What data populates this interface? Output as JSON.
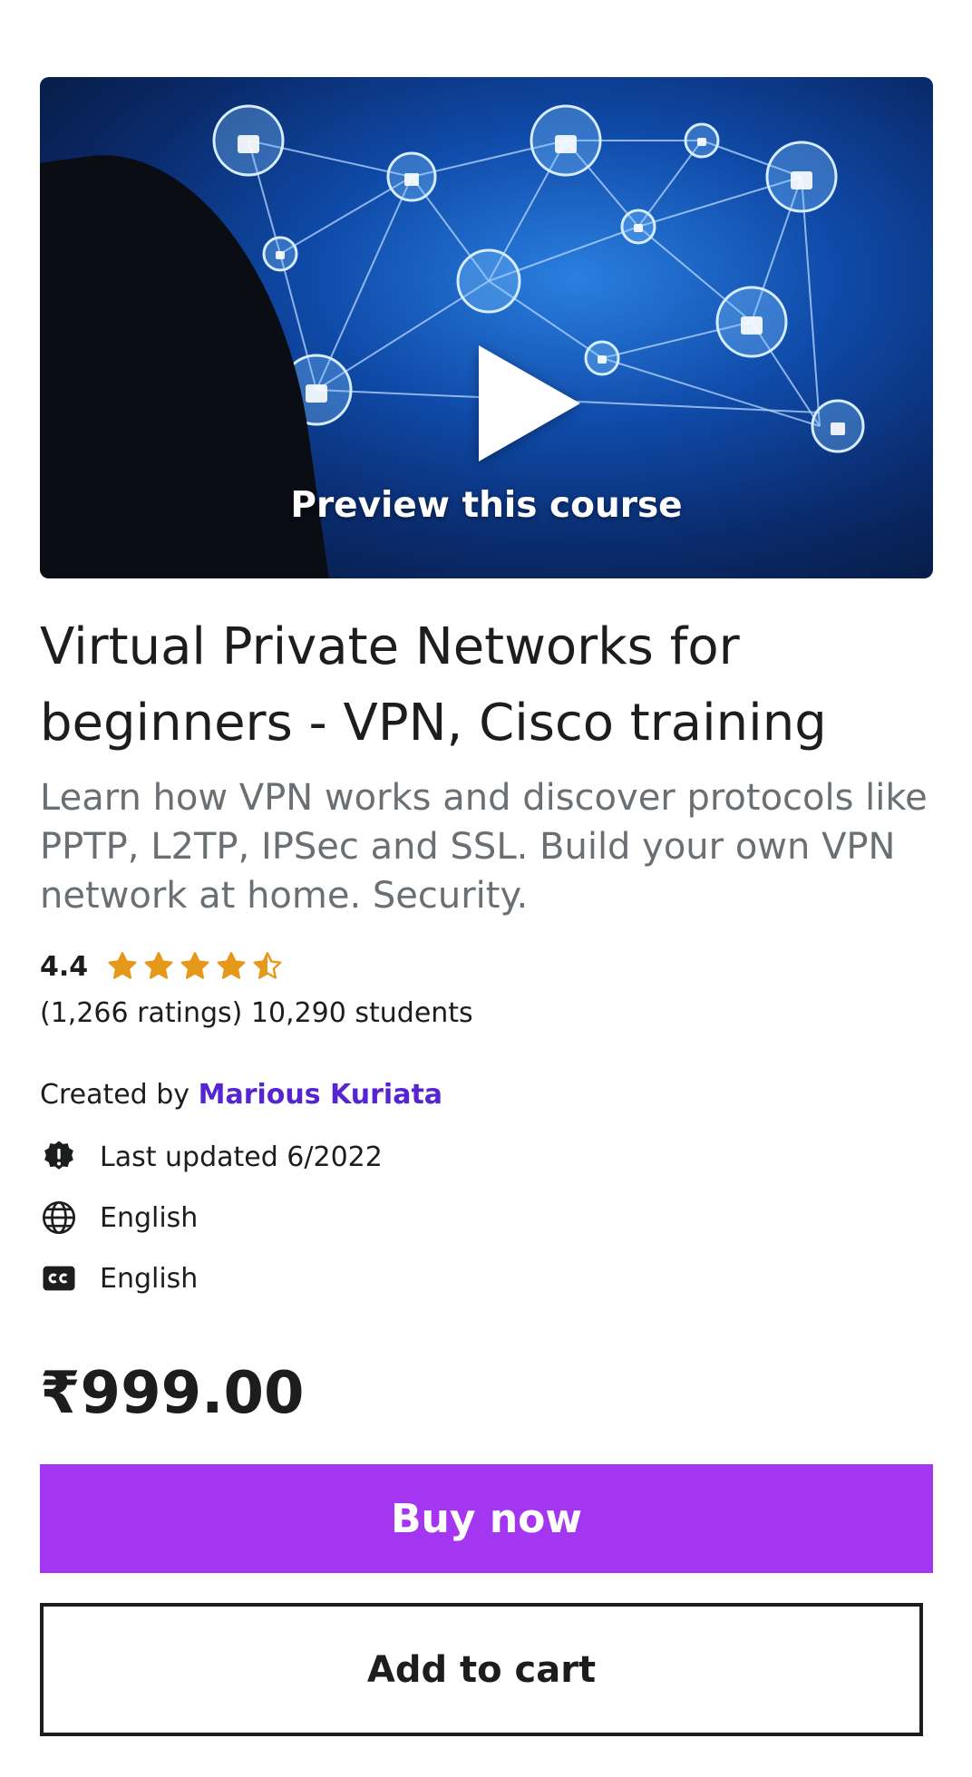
{
  "preview": {
    "label": "Preview this course"
  },
  "course": {
    "title": "Virtual Private Networks for beginners - VPN, Cisco training",
    "subtitle": "Learn how VPN works and discover protocols like PPTP, L2TP, IPSec and SSL. Build your own VPN network at home. Security.",
    "rating": "4.4",
    "rating_stars": 4.4,
    "rating_counts": "(1,266 ratings) 10,290 students",
    "created_by_prefix": "Created by",
    "author": "Marious Kuriata",
    "last_updated": "Last updated 6/2022",
    "language": "English",
    "captions": "English"
  },
  "purchase": {
    "price": "₹999.00",
    "buy_label": "Buy now",
    "cart_label": "Add to cart"
  },
  "colors": {
    "accent": "#a435f0",
    "author_link": "#5624d0",
    "star": "#e59819",
    "text": "#1c1d1f",
    "muted": "#6a6f73"
  }
}
